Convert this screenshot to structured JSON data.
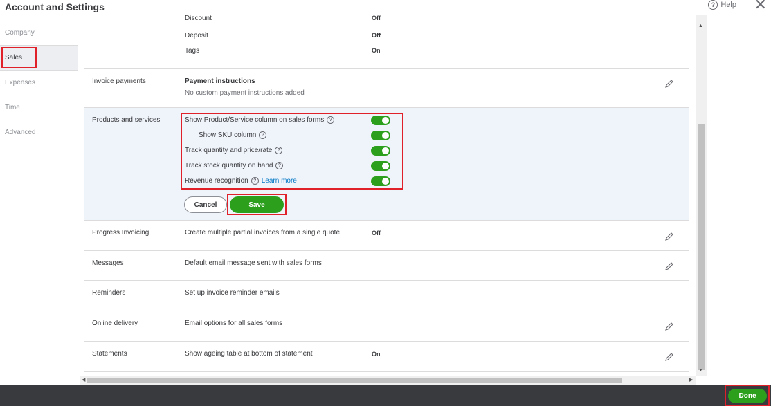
{
  "header": {
    "title": "Account and Settings",
    "help_label": "Help",
    "help_icon": "?",
    "close_icon": "✕"
  },
  "nav": {
    "items": [
      "Company",
      "Sales",
      "Expenses",
      "Time",
      "Advanced"
    ],
    "active": "Sales"
  },
  "top_list": [
    {
      "label": "Discount",
      "value": "Off"
    },
    {
      "label": "Deposit",
      "value": "Off"
    },
    {
      "label": "Tags",
      "value": "On"
    }
  ],
  "invoice_payments": {
    "title": "Invoice payments",
    "heading": "Payment instructions",
    "desc": "No custom payment instructions added"
  },
  "products_services": {
    "title": "Products and services",
    "options": [
      {
        "label": "Show Product/Service column on sales forms",
        "on": true
      },
      {
        "label": "Show SKU column",
        "on": true
      },
      {
        "label": "Track quantity and price/rate",
        "on": true
      },
      {
        "label": "Track stock quantity on hand",
        "on": true
      },
      {
        "label": "Revenue recognition",
        "link": "Learn more",
        "on": true
      }
    ],
    "cancel_label": "Cancel",
    "save_label": "Save"
  },
  "rows": [
    {
      "title": "Progress Invoicing",
      "desc": "Create multiple partial invoices from a single quote",
      "value": "Off",
      "editable": true
    },
    {
      "title": "Messages",
      "desc": "Default email message sent with sales forms",
      "value": "",
      "editable": true
    },
    {
      "title": "Reminders",
      "desc": "Set up invoice reminder emails",
      "value": "",
      "editable": false
    },
    {
      "title": "Online delivery",
      "desc": "Email options for all sales forms",
      "value": "",
      "editable": true
    },
    {
      "title": "Statements",
      "desc": "Show ageing table at bottom of statement",
      "value": "On",
      "editable": true
    }
  ],
  "footer": {
    "done_label": "Done"
  },
  "colors": {
    "accent_green": "#2ca01c",
    "highlight_red": "#e0212a",
    "footer_bg": "#393a3d",
    "link_blue": "#0077c5"
  }
}
